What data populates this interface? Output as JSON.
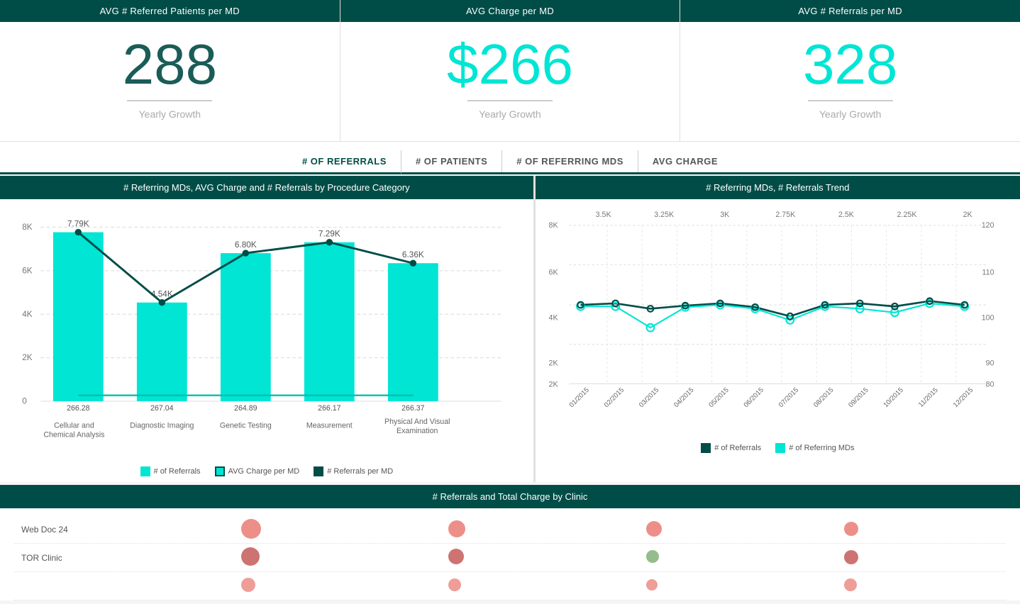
{
  "kpis": [
    {
      "id": "avg-referred",
      "header": "AVG # Referred Patients per MD",
      "value": "288",
      "value_color": "dark",
      "subtitle": "Yearly Growth"
    },
    {
      "id": "avg-charge",
      "header": "AVG Charge per MD",
      "value": "$266",
      "value_color": "cyan",
      "subtitle": "Yearly Growth"
    },
    {
      "id": "avg-referrals",
      "header": "AVG # Referrals per MD",
      "value": "328",
      "value_color": "cyan",
      "subtitle": "Yearly Growth"
    }
  ],
  "tabs": [
    {
      "id": "referrals",
      "label": "# OF REFERRALS",
      "active": true
    },
    {
      "id": "patients",
      "label": "# OF PATIENTS",
      "active": false
    },
    {
      "id": "referring-mds",
      "label": "# OF REFERRING MDS",
      "active": false
    },
    {
      "id": "avg-charge",
      "label": "AVG CHARGE",
      "active": false
    }
  ],
  "bar_chart": {
    "title": "# Referring MDs, AVG Charge and # Referrals by Procedure Category",
    "categories": [
      "Cellular and Chemical Analysis",
      "Diagnostic Imaging",
      "Genetic Testing",
      "Measurement",
      "Physical And Visual Examination"
    ],
    "bar_values": [
      7790,
      4540,
      6800,
      7290,
      6360
    ],
    "bar_labels": [
      "7.79K",
      "4.54K",
      "6.80K",
      "7.29K",
      "6.36K"
    ],
    "line_values": [
      266.28,
      267.04,
      264.89,
      266.17,
      266.37
    ],
    "line_labels": [
      "266.28",
      "267.04",
      "264.89",
      "266.17",
      "266.37"
    ],
    "y_axis": [
      "8K",
      "6K",
      "4K",
      "2K",
      "0"
    ],
    "legend": [
      {
        "color": "cyan",
        "label": "# of Referrals"
      },
      {
        "color": "teal",
        "label": "AVG Charge per MD"
      },
      {
        "color": "dark",
        "label": "# Referrals per MD"
      }
    ]
  },
  "trend_chart": {
    "title": "# Referring MDs, # Referrals Trend",
    "x_labels": [
      "01/2015",
      "02/2015",
      "03/2015",
      "04/2015",
      "05/2015",
      "06/2015",
      "07/2015",
      "08/2015",
      "09/2015",
      "10/2015",
      "11/2015",
      "12/2015"
    ],
    "left_y": [
      "8K",
      "6K",
      "4K",
      "2K",
      "2K"
    ],
    "right_y": [
      "120",
      "110",
      "100",
      "90",
      "80"
    ],
    "top_labels": [
      "3.5K",
      "3.25K",
      "3K",
      "2.75K",
      "2.5K",
      "2.25K",
      "2K"
    ],
    "legend": [
      {
        "color": "dark",
        "label": "# of Referrals"
      },
      {
        "color": "cyan",
        "label": "# of Referring MDs"
      }
    ]
  },
  "bottom_chart": {
    "title": "# Referrals and Total Charge by Clinic",
    "clinics": [
      {
        "name": "Web Doc 24",
        "bubbles": [
          {
            "x": 35,
            "size": 28,
            "color": "salmon"
          },
          {
            "x": 55,
            "size": 24,
            "color": "salmon"
          },
          {
            "x": 70,
            "size": 22,
            "color": "salmon"
          },
          {
            "x": 88,
            "size": 20,
            "color": "salmon"
          }
        ]
      },
      {
        "name": "TOR Clinic",
        "bubbles": [
          {
            "x": 35,
            "size": 26,
            "color": "dark-salmon"
          },
          {
            "x": 55,
            "size": 22,
            "color": "dark-salmon"
          },
          {
            "x": 70,
            "size": 18,
            "color": "green"
          },
          {
            "x": 88,
            "size": 20,
            "color": "dark-salmon"
          }
        ]
      },
      {
        "name": "",
        "bubbles": [
          {
            "x": 35,
            "size": 20,
            "color": "salmon"
          },
          {
            "x": 55,
            "size": 18,
            "color": "salmon"
          },
          {
            "x": 70,
            "size": 16,
            "color": "salmon"
          },
          {
            "x": 88,
            "size": 18,
            "color": "salmon"
          }
        ]
      }
    ]
  }
}
